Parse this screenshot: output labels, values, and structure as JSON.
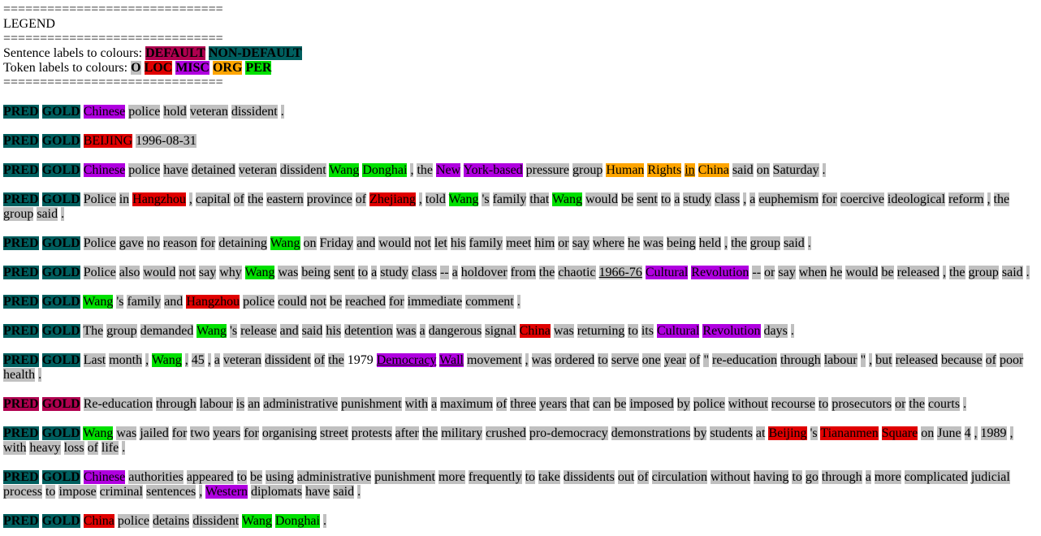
{
  "legend": {
    "rule": "==============================",
    "title": "LEGEND",
    "sentence_label_text": "Sentence labels to colours:",
    "sentence_labels": [
      {
        "label": "DEFAULT",
        "color": "#b0004f"
      },
      {
        "label": "NON-DEFAULT",
        "color": "#005f5f"
      }
    ],
    "token_label_text": "Token labels to colours:",
    "token_labels": [
      {
        "label": "O",
        "color": "#c0c0c0"
      },
      {
        "label": "LOC",
        "color": "#e00000"
      },
      {
        "label": "MISC",
        "color": "#b000e0"
      },
      {
        "label": "ORG",
        "color": "#ffa500"
      },
      {
        "label": "PER",
        "color": "#00e000"
      }
    ]
  },
  "sentences": [
    {
      "status": "NON-DEFAULT",
      "pred": "PRED",
      "gold": "GOLD",
      "tokens": [
        [
          "Chinese",
          "MISC"
        ],
        [
          "police",
          "O"
        ],
        [
          "hold",
          "O"
        ],
        [
          "veteran",
          "O"
        ],
        [
          "dissident",
          "O"
        ],
        [
          ".",
          "O"
        ]
      ]
    },
    {
      "status": "NON-DEFAULT",
      "pred": "PRED",
      "gold": "GOLD",
      "tokens": [
        [
          "BEIJING",
          "LOC"
        ],
        [
          "1996-08-31",
          "O"
        ]
      ]
    },
    {
      "status": "NON-DEFAULT",
      "pred": "PRED",
      "gold": "GOLD",
      "tokens": [
        [
          "Chinese",
          "MISC"
        ],
        [
          "police",
          "O"
        ],
        [
          "have",
          "O"
        ],
        [
          "detained",
          "O"
        ],
        [
          "veteran",
          "O"
        ],
        [
          "dissident",
          "O"
        ],
        [
          "Wang",
          "PER"
        ],
        [
          "Donghai",
          "PER"
        ],
        [
          ",",
          "O"
        ],
        [
          "the",
          "O"
        ],
        [
          "New",
          "MISC"
        ],
        [
          "York-based",
          "MISC"
        ],
        [
          "pressure",
          "O"
        ],
        [
          "group",
          "O"
        ],
        [
          "Human",
          "ORG"
        ],
        [
          "Rights",
          "ORG"
        ],
        [
          "in",
          "ORG",
          "u"
        ],
        [
          "China",
          "ORG"
        ],
        [
          "said",
          "O"
        ],
        [
          "on",
          "O"
        ],
        [
          "Saturday",
          "O"
        ],
        [
          ".",
          "O"
        ]
      ]
    },
    {
      "status": "NON-DEFAULT",
      "pred": "PRED",
      "gold": "GOLD",
      "tokens": [
        [
          "Police",
          "O"
        ],
        [
          "in",
          "O"
        ],
        [
          "Hangzhou",
          "LOC"
        ],
        [
          ",",
          "O"
        ],
        [
          "capital",
          "O"
        ],
        [
          "of",
          "O"
        ],
        [
          "the",
          "O"
        ],
        [
          "eastern",
          "O"
        ],
        [
          "province",
          "O"
        ],
        [
          "of",
          "O"
        ],
        [
          "Zhejiang",
          "LOC"
        ],
        [
          ",",
          "O"
        ],
        [
          "told",
          "O"
        ],
        [
          "Wang",
          "PER"
        ],
        [
          "'s",
          "O"
        ],
        [
          "family",
          "O"
        ],
        [
          "that",
          "O"
        ],
        [
          "Wang",
          "PER"
        ],
        [
          "would",
          "O"
        ],
        [
          "be",
          "O"
        ],
        [
          "sent",
          "O"
        ],
        [
          "to",
          "O"
        ],
        [
          "a",
          "O"
        ],
        [
          "study",
          "O"
        ],
        [
          "class",
          "O"
        ],
        [
          ",",
          "O"
        ],
        [
          "a",
          "O"
        ],
        [
          "euphemism",
          "O"
        ],
        [
          "for",
          "O"
        ],
        [
          "coercive",
          "O"
        ],
        [
          "ideological",
          "O"
        ],
        [
          "reform",
          "O"
        ],
        [
          ",",
          "O"
        ],
        [
          "the",
          "O"
        ],
        [
          "group",
          "O"
        ],
        [
          "said",
          "O"
        ],
        [
          ".",
          "O"
        ]
      ]
    },
    {
      "status": "NON-DEFAULT",
      "pred": "PRED",
      "gold": "GOLD",
      "tokens": [
        [
          "Police",
          "O"
        ],
        [
          "gave",
          "O"
        ],
        [
          "no",
          "O"
        ],
        [
          "reason",
          "O"
        ],
        [
          "for",
          "O"
        ],
        [
          "detaining",
          "O"
        ],
        [
          "Wang",
          "PER"
        ],
        [
          "on",
          "O"
        ],
        [
          "Friday",
          "O"
        ],
        [
          "and",
          "O"
        ],
        [
          "would",
          "O"
        ],
        [
          "not",
          "O"
        ],
        [
          "let",
          "O"
        ],
        [
          "his",
          "O"
        ],
        [
          "family",
          "O"
        ],
        [
          "meet",
          "O"
        ],
        [
          "him",
          "O"
        ],
        [
          "or",
          "O"
        ],
        [
          "say",
          "O"
        ],
        [
          "where",
          "O"
        ],
        [
          "he",
          "O"
        ],
        [
          "was",
          "O"
        ],
        [
          "being",
          "O"
        ],
        [
          "held",
          "O"
        ],
        [
          ",",
          "O"
        ],
        [
          "the",
          "O"
        ],
        [
          "group",
          "O"
        ],
        [
          "said",
          "O"
        ],
        [
          ".",
          "O"
        ]
      ]
    },
    {
      "status": "NON-DEFAULT",
      "pred": "PRED",
      "gold": "GOLD",
      "tokens": [
        [
          "Police",
          "O"
        ],
        [
          "also",
          "O"
        ],
        [
          "would",
          "O"
        ],
        [
          "not",
          "O"
        ],
        [
          "say",
          "O"
        ],
        [
          "why",
          "O"
        ],
        [
          "Wang",
          "PER"
        ],
        [
          "was",
          "O"
        ],
        [
          "being",
          "O"
        ],
        [
          "sent",
          "O"
        ],
        [
          "to",
          "O"
        ],
        [
          "a",
          "O"
        ],
        [
          "study",
          "O"
        ],
        [
          "class",
          "O"
        ],
        [
          "--",
          "O"
        ],
        [
          "a",
          "O"
        ],
        [
          "holdover",
          "O"
        ],
        [
          "from",
          "O"
        ],
        [
          "the",
          "O"
        ],
        [
          "chaotic",
          "O"
        ],
        [
          "1966-76",
          "O",
          "u"
        ],
        [
          "Cultural",
          "MISC"
        ],
        [
          "Revolution",
          "MISC"
        ],
        [
          "--",
          "O"
        ],
        [
          "or",
          "O"
        ],
        [
          "say",
          "O"
        ],
        [
          "when",
          "O"
        ],
        [
          "he",
          "O"
        ],
        [
          "would",
          "O"
        ],
        [
          "be",
          "O"
        ],
        [
          "released",
          "O"
        ],
        [
          ",",
          "O"
        ],
        [
          "the",
          "O"
        ],
        [
          "group",
          "O"
        ],
        [
          "said",
          "O"
        ],
        [
          ".",
          "O"
        ]
      ]
    },
    {
      "status": "NON-DEFAULT",
      "pred": "PRED",
      "gold": "GOLD",
      "tokens": [
        [
          "Wang",
          "PER"
        ],
        [
          "'s",
          "O"
        ],
        [
          "family",
          "O"
        ],
        [
          "and",
          "O"
        ],
        [
          "Hangzhou",
          "LOC"
        ],
        [
          "police",
          "O"
        ],
        [
          "could",
          "O"
        ],
        [
          "not",
          "O"
        ],
        [
          "be",
          "O"
        ],
        [
          "reached",
          "O"
        ],
        [
          "for",
          "O"
        ],
        [
          "immediate",
          "O"
        ],
        [
          "comment",
          "O"
        ],
        [
          ".",
          "O"
        ]
      ]
    },
    {
      "status": "NON-DEFAULT",
      "pred": "PRED",
      "gold": "GOLD",
      "tokens": [
        [
          "The",
          "O"
        ],
        [
          "group",
          "O"
        ],
        [
          "demanded",
          "O"
        ],
        [
          "Wang",
          "PER"
        ],
        [
          "'s",
          "O"
        ],
        [
          "release",
          "O"
        ],
        [
          "and",
          "O"
        ],
        [
          "said",
          "O"
        ],
        [
          "his",
          "O"
        ],
        [
          "detention",
          "O"
        ],
        [
          "was",
          "O"
        ],
        [
          "a",
          "O"
        ],
        [
          "dangerous",
          "O"
        ],
        [
          "signal",
          "O"
        ],
        [
          "China",
          "LOC"
        ],
        [
          "was",
          "O"
        ],
        [
          "returning",
          "O"
        ],
        [
          "to",
          "O"
        ],
        [
          "its",
          "O"
        ],
        [
          "Cultural",
          "MISC"
        ],
        [
          "Revolution",
          "MISC"
        ],
        [
          "days",
          "O"
        ],
        [
          ".",
          "O"
        ]
      ]
    },
    {
      "status": "NON-DEFAULT",
      "pred": "PRED",
      "gold": "GOLD",
      "tokens": [
        [
          "Last",
          "O"
        ],
        [
          "month",
          "O"
        ],
        [
          ",",
          "O"
        ],
        [
          "Wang",
          "PER"
        ],
        [
          ",",
          "O"
        ],
        [
          "45",
          "O"
        ],
        [
          ",",
          "O"
        ],
        [
          "a",
          "O"
        ],
        [
          "veteran",
          "O"
        ],
        [
          "dissident",
          "O"
        ],
        [
          "of",
          "O"
        ],
        [
          "the",
          "O"
        ],
        [
          "1979",
          "O",
          "n"
        ],
        [
          "Democracy",
          "MISC",
          "u"
        ],
        [
          "Wall",
          "MISC",
          "u"
        ],
        [
          "movement",
          "O"
        ],
        [
          ",",
          "O"
        ],
        [
          "was",
          "O"
        ],
        [
          "ordered",
          "O"
        ],
        [
          "to",
          "O"
        ],
        [
          "serve",
          "O"
        ],
        [
          "one",
          "O"
        ],
        [
          "year",
          "O"
        ],
        [
          "of",
          "O"
        ],
        [
          "\"",
          "O"
        ],
        [
          "re-education",
          "O"
        ],
        [
          "through",
          "O"
        ],
        [
          "labour",
          "O"
        ],
        [
          "\"",
          "O"
        ],
        [
          ",",
          "O"
        ],
        [
          "but",
          "O"
        ],
        [
          "released",
          "O"
        ],
        [
          "because",
          "O"
        ],
        [
          "of",
          "O"
        ],
        [
          "poor",
          "O"
        ],
        [
          "health",
          "O"
        ],
        [
          ".",
          "O"
        ]
      ]
    },
    {
      "status": "DEFAULT",
      "pred": "PRED",
      "gold": "GOLD",
      "tokens": [
        [
          "Re-education",
          "O"
        ],
        [
          "through",
          "O"
        ],
        [
          "labour",
          "O"
        ],
        [
          "is",
          "O"
        ],
        [
          "an",
          "O"
        ],
        [
          "administrative",
          "O"
        ],
        [
          "punishment",
          "O"
        ],
        [
          "with",
          "O"
        ],
        [
          "a",
          "O"
        ],
        [
          "maximum",
          "O"
        ],
        [
          "of",
          "O"
        ],
        [
          "three",
          "O"
        ],
        [
          "years",
          "O"
        ],
        [
          "that",
          "O"
        ],
        [
          "can",
          "O"
        ],
        [
          "be",
          "O"
        ],
        [
          "imposed",
          "O"
        ],
        [
          "by",
          "O"
        ],
        [
          "police",
          "O"
        ],
        [
          "without",
          "O"
        ],
        [
          "recourse",
          "O"
        ],
        [
          "to",
          "O"
        ],
        [
          "prosecutors",
          "O"
        ],
        [
          "or",
          "O"
        ],
        [
          "the",
          "O"
        ],
        [
          "courts",
          "O"
        ],
        [
          ".",
          "O"
        ]
      ]
    },
    {
      "status": "NON-DEFAULT",
      "pred": "PRED",
      "gold": "GOLD",
      "tokens": [
        [
          "Wang",
          "PER"
        ],
        [
          "was",
          "O"
        ],
        [
          "jailed",
          "O"
        ],
        [
          "for",
          "O"
        ],
        [
          "two",
          "O"
        ],
        [
          "years",
          "O"
        ],
        [
          "for",
          "O"
        ],
        [
          "organising",
          "O"
        ],
        [
          "street",
          "O"
        ],
        [
          "protests",
          "O"
        ],
        [
          "after",
          "O"
        ],
        [
          "the",
          "O"
        ],
        [
          "military",
          "O"
        ],
        [
          "crushed",
          "O"
        ],
        [
          "pro-democracy",
          "O"
        ],
        [
          "demonstrations",
          "O"
        ],
        [
          "by",
          "O"
        ],
        [
          "students",
          "O"
        ],
        [
          "at",
          "O"
        ],
        [
          "Beijing",
          "LOC"
        ],
        [
          "'s",
          "O"
        ],
        [
          "Tiananmen",
          "LOC"
        ],
        [
          "Square",
          "LOC"
        ],
        [
          "on",
          "O"
        ],
        [
          "June",
          "O"
        ],
        [
          "4",
          "O"
        ],
        [
          ",",
          "O"
        ],
        [
          "1989",
          "O"
        ],
        [
          ",",
          "O"
        ],
        [
          "with",
          "O"
        ],
        [
          "heavy",
          "O"
        ],
        [
          "loss",
          "O"
        ],
        [
          "of",
          "O"
        ],
        [
          "life",
          "O"
        ],
        [
          ".",
          "O"
        ]
      ]
    },
    {
      "status": "NON-DEFAULT",
      "pred": "PRED",
      "gold": "GOLD",
      "tokens": [
        [
          "Chinese",
          "MISC"
        ],
        [
          "authorities",
          "O"
        ],
        [
          "appeared",
          "O"
        ],
        [
          "to",
          "O"
        ],
        [
          "be",
          "O"
        ],
        [
          "using",
          "O"
        ],
        [
          "administrative",
          "O"
        ],
        [
          "punishment",
          "O"
        ],
        [
          "more",
          "O"
        ],
        [
          "frequently",
          "O"
        ],
        [
          "to",
          "O"
        ],
        [
          "take",
          "O"
        ],
        [
          "dissidents",
          "O"
        ],
        [
          "out",
          "O"
        ],
        [
          "of",
          "O"
        ],
        [
          "circulation",
          "O"
        ],
        [
          "without",
          "O"
        ],
        [
          "having",
          "O"
        ],
        [
          "to",
          "O"
        ],
        [
          "go",
          "O"
        ],
        [
          "through",
          "O"
        ],
        [
          "a",
          "O"
        ],
        [
          "more",
          "O"
        ],
        [
          "complicated",
          "O"
        ],
        [
          "judicial",
          "O"
        ],
        [
          "process",
          "O"
        ],
        [
          "to",
          "O"
        ],
        [
          "impose",
          "O"
        ],
        [
          "criminal",
          "O"
        ],
        [
          "sentences",
          "O"
        ],
        [
          ",",
          "O"
        ],
        [
          "Western",
          "MISC"
        ],
        [
          "diplomats",
          "O"
        ],
        [
          "have",
          "O"
        ],
        [
          "said",
          "O"
        ],
        [
          ".",
          "O"
        ]
      ]
    },
    {
      "status": "NON-DEFAULT",
      "pred": "PRED",
      "gold": "GOLD",
      "tokens": [
        [
          "China",
          "LOC"
        ],
        [
          "police",
          "O"
        ],
        [
          "detains",
          "O"
        ],
        [
          "dissident",
          "O"
        ],
        [
          "Wang",
          "PER"
        ],
        [
          "Donghai",
          "PER"
        ],
        [
          ".",
          "O"
        ]
      ]
    }
  ]
}
